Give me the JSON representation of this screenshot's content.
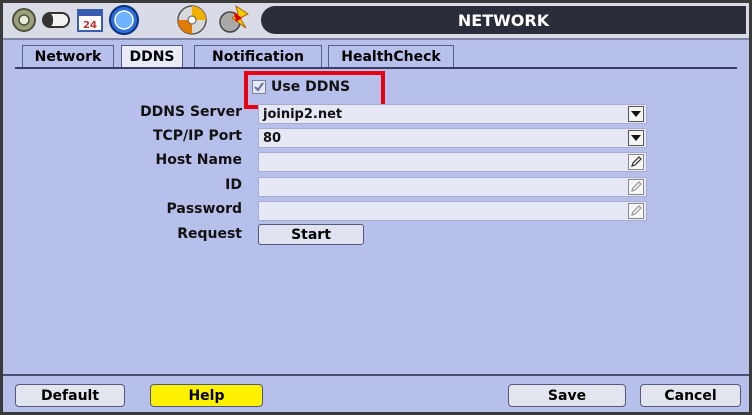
{
  "title": "NETWORK",
  "icons": [
    "settings-gear-icon",
    "camera-icon",
    "schedule-24-icon",
    "network-globe-icon",
    "storage-disc-icon",
    "system-tools-icon"
  ],
  "tabs": [
    {
      "label": "Network",
      "active": false
    },
    {
      "label": "DDNS",
      "active": true
    },
    {
      "label": "Notification",
      "active": false
    },
    {
      "label": "HealthCheck",
      "active": false
    }
  ],
  "form": {
    "use_ddns": {
      "label": "Use DDNS",
      "checked": true
    },
    "ddns_server": {
      "label": "DDNS Server",
      "value": "joinip2.net"
    },
    "tcp_port": {
      "label": "TCP/IP Port",
      "value": "80"
    },
    "host_name": {
      "label": "Host Name",
      "value": ""
    },
    "id": {
      "label": "ID",
      "value": ""
    },
    "password": {
      "label": "Password",
      "value": ""
    },
    "request": {
      "label": "Request",
      "button": "Start"
    }
  },
  "footer": {
    "default": "Default",
    "help": "Help",
    "save": "Save",
    "cancel": "Cancel"
  },
  "colors": {
    "panel": "#b7c0eb",
    "highlight": "#e60012",
    "help": "#fff200",
    "titlebar": "#2b2d3a"
  }
}
